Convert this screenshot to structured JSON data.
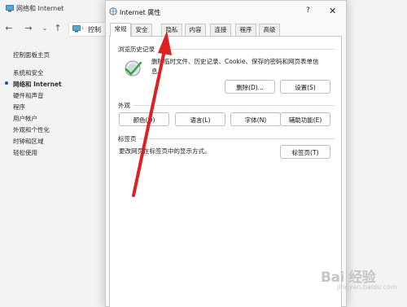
{
  "background_window": {
    "title": "网络和 Internet",
    "address_text": "控制",
    "sidebar": {
      "items": [
        {
          "label": "控制面板主页",
          "active": false
        },
        {
          "label": "系统和安全",
          "active": false
        },
        {
          "label": "网络和 Internet",
          "active": true
        },
        {
          "label": "硬件和声音",
          "active": false
        },
        {
          "label": "程序",
          "active": false
        },
        {
          "label": "用户帐户",
          "active": false
        },
        {
          "label": "外观和个性化",
          "active": false
        },
        {
          "label": "时钟和区域",
          "active": false
        },
        {
          "label": "轻松使用",
          "active": false
        }
      ]
    }
  },
  "dialog": {
    "title": "Internet 属性",
    "help_glyph": "?",
    "close_glyph": "✕",
    "tabs": [
      {
        "label": "常规",
        "active": true
      },
      {
        "label": "安全",
        "active": false
      },
      {
        "label": "隐私",
        "active": false
      },
      {
        "label": "内容",
        "active": false
      },
      {
        "label": "连接",
        "active": false
      },
      {
        "label": "程序",
        "active": false
      },
      {
        "label": "高级",
        "active": false
      }
    ],
    "browsing_history": {
      "label": "浏览历史记录",
      "desc_line1": "删除临时文件、历史记录、Cookie、保存的密码和网页表单信",
      "desc_line2": "息。",
      "delete_button": "删除(D)...",
      "settings_button": "设置(S)"
    },
    "appearance": {
      "label": "外观",
      "colors_button": "颜色(O)",
      "languages_button": "语言(L)",
      "fonts_button": "字体(N)",
      "accessibility_button": "辅助功能(E)"
    },
    "tabs_section": {
      "label": "标签页",
      "desc": "更改网页在标签页中的显示方式。",
      "tabs_button": "标签页(T)"
    }
  },
  "watermark": {
    "brand": "Bai 经验",
    "sub": "jingyan.baidu.com"
  },
  "colors": {
    "arrow": "#e02020",
    "accent": "#1f4e9c"
  }
}
